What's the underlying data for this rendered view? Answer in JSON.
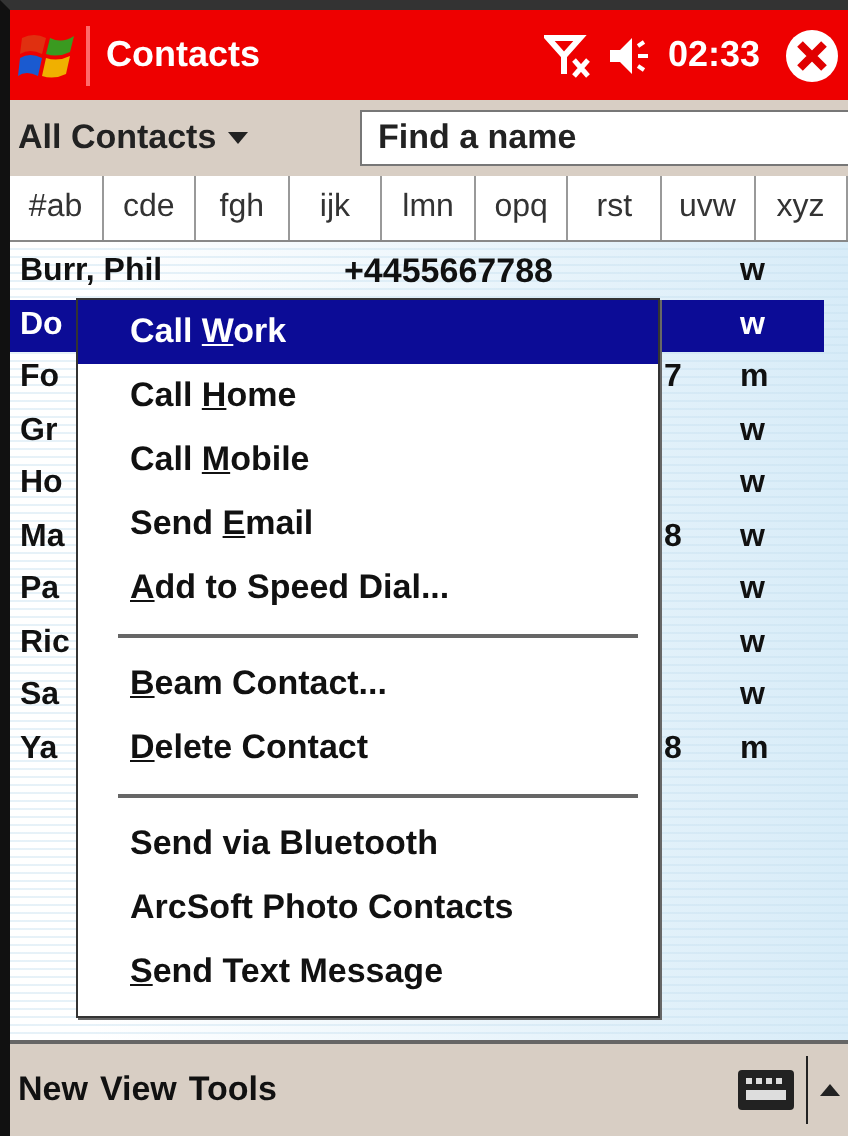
{
  "title_bar": {
    "title": "Contacts",
    "time": "02:33"
  },
  "toolbar": {
    "filter": "All Contacts",
    "search": {
      "placeholder": "Find a name"
    }
  },
  "letter_tabs": [
    "#ab",
    "cde",
    "fgh",
    "ijk",
    "lmn",
    "opq",
    "rst",
    "uvw",
    "xyz"
  ],
  "contacts": [
    {
      "name": "Burr, Phil",
      "phone": "+4455667788",
      "type": "w",
      "selected": false
    },
    {
      "name": "Do",
      "type": "w",
      "selected": true
    },
    {
      "name": "Fo",
      "phone_tail": "7",
      "type": "m",
      "selected": false
    },
    {
      "name": "Gr",
      "type": "w",
      "selected": false
    },
    {
      "name": "Ho",
      "type": "w",
      "selected": false
    },
    {
      "name": "Ma",
      "phone_tail": "8",
      "type": "w",
      "selected": false
    },
    {
      "name": "Pa",
      "type": "w",
      "selected": false
    },
    {
      "name": "Ric",
      "type": "w",
      "selected": false
    },
    {
      "name": "Sa",
      "type": "w",
      "selected": false
    },
    {
      "name": "Ya",
      "phone_tail": "8",
      "type": "m",
      "selected": false
    }
  ],
  "context_menu": {
    "items": [
      {
        "kind": "item",
        "before": "Call ",
        "key": "W",
        "after": "ork",
        "selected": true
      },
      {
        "kind": "item",
        "before": "Call ",
        "key": "H",
        "after": "ome",
        "selected": false
      },
      {
        "kind": "item",
        "before": "Call ",
        "key": "M",
        "after": "obile",
        "selected": false
      },
      {
        "kind": "item",
        "before": "Send ",
        "key": "E",
        "after": "mail",
        "selected": false
      },
      {
        "kind": "item",
        "key": "A",
        "after": "dd to Speed Dial...",
        "selected": false
      },
      {
        "kind": "separator"
      },
      {
        "kind": "item",
        "key": "B",
        "after": "eam Contact...",
        "selected": false
      },
      {
        "kind": "item",
        "key": "D",
        "after": "elete Contact",
        "selected": false
      },
      {
        "kind": "separator"
      },
      {
        "kind": "item",
        "before": "Send via Bluetooth",
        "selected": false
      },
      {
        "kind": "item",
        "before": "ArcSoft Photo Contacts",
        "selected": false
      },
      {
        "kind": "item",
        "key": "S",
        "after": "end Text Message",
        "selected": false
      }
    ]
  },
  "menu_bar": {
    "items": [
      "New",
      "View",
      "Tools"
    ]
  }
}
